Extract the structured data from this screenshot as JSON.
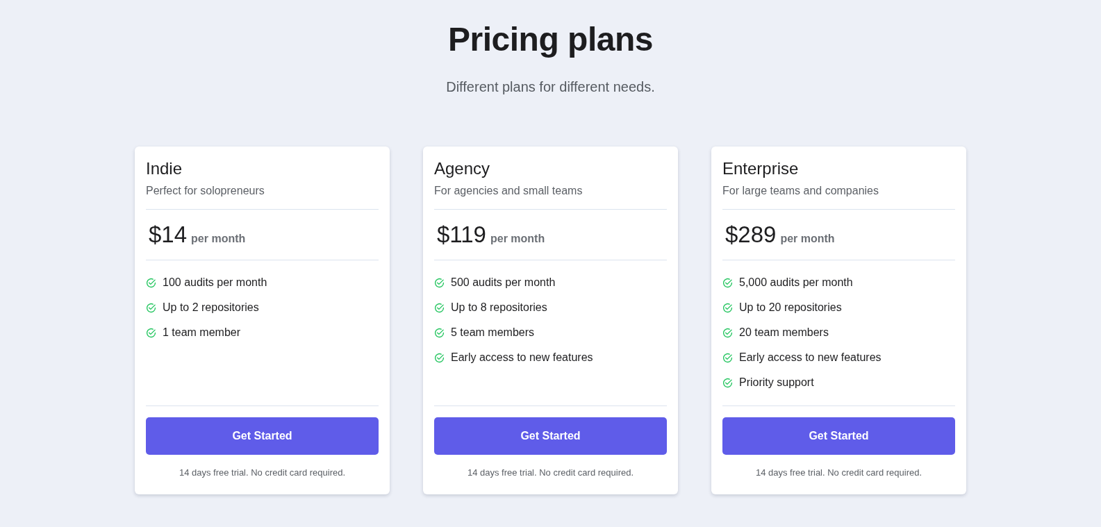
{
  "header": {
    "title": "Pricing plans",
    "subtitle": "Different plans for different needs."
  },
  "plans": [
    {
      "name": "Indie",
      "description": "Perfect for solopreneurs",
      "price": "$14",
      "period": "per month",
      "features": [
        "100 audits per month",
        "Up to 2 repositories",
        "1 team member"
      ],
      "button": "Get Started",
      "note": "14 days free trial. No credit card required."
    },
    {
      "name": "Agency",
      "description": "For agencies and small teams",
      "price": "$119",
      "period": "per month",
      "features": [
        "500 audits per month",
        "Up to 8 repositories",
        "5 team members",
        "Early access to new features"
      ],
      "button": "Get Started",
      "note": "14 days free trial. No credit card required."
    },
    {
      "name": "Enterprise",
      "description": "For large teams and companies",
      "price": "$289",
      "period": "per month",
      "features": [
        "5,000 audits per month",
        "Up to 20 repositories",
        "20 team members",
        "Early access to new features",
        "Priority support"
      ],
      "button": "Get Started",
      "note": "14 days free trial. No credit card required."
    }
  ]
}
